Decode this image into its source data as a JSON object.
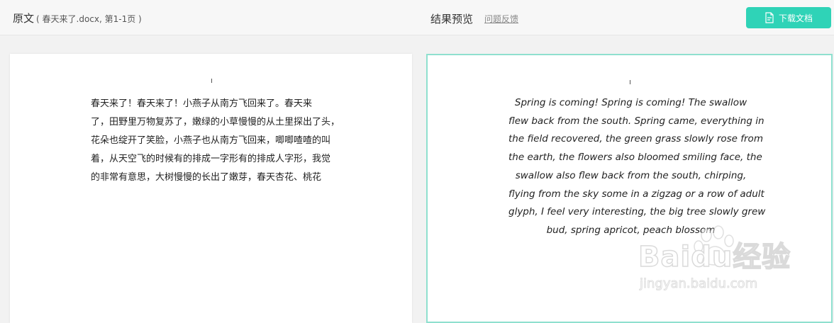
{
  "header": {
    "original_label": "原文",
    "original_meta": "( 春天来了.docx,  第1-1页 )",
    "preview_label": "结果预览",
    "feedback_link": "问题反馈",
    "download_button": "下载文档"
  },
  "original_doc": {
    "lines": [
      "春天来了！春天来了！小燕子从南方飞回来了。春天来",
      "了，田野里万物复苏了，嫩绿的小草慢慢的从土里探出了头，",
      "花朵也绽开了笑脸，小燕子也从南方飞回来，唧唧喳喳的叫",
      "着，从天空飞的时候有的排成一字形有的排成人字形，我觉",
      "的非常有意思，大树慢慢的长出了嫩芽，春天杏花、桃花"
    ]
  },
  "preview_doc": {
    "lines": [
      "Spring is coming! Spring is coming! The swallow",
      "flew back from the south. Spring came, everything in",
      "the field recovered, the green grass slowly rose from",
      "the earth, the flowers also bloomed smiling face, the",
      "swallow also flew back from the south, chirping,",
      "flying from the sky some in a zigzag or a row of adult",
      "glyph, I feel very interesting, the big tree slowly grew",
      "bud, spring apricot, peach blossom"
    ]
  },
  "watermark": {
    "logo_text": "Baidu经验",
    "url_text": "jingyan.baidu.com"
  },
  "colors": {
    "accent": "#2fd3b7",
    "preview_border": "#8fe0cf",
    "background": "#f2f2f2"
  },
  "icons": {
    "download": "document-icon"
  }
}
